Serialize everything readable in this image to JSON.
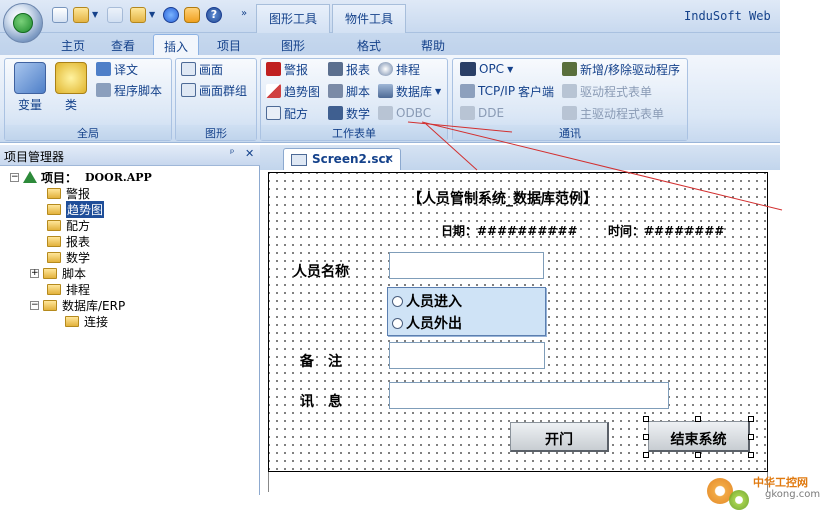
{
  "title_bar": {
    "brand": "InduSoft Web",
    "context_tabs": [
      "图形工具",
      "物件工具"
    ]
  },
  "tabs": [
    {
      "label": "主页"
    },
    {
      "label": "查看"
    },
    {
      "label": "插入",
      "active": true
    },
    {
      "label": "项目"
    },
    {
      "label": "图形"
    },
    {
      "label": "格式"
    },
    {
      "label": "帮助"
    }
  ],
  "ribbon": {
    "global": {
      "label": "全局",
      "variables": "变量",
      "classes": "类",
      "translate": "译文",
      "program_script": "程序脚本"
    },
    "graphics": {
      "label": "图形",
      "screen": "画面",
      "screen_group": "画面群组"
    },
    "worksheets": {
      "label": "工作表单",
      "alarm": "警报",
      "report": "报表",
      "schedule": "排程",
      "trend": "趋势图",
      "script": "脚本",
      "database": "数据库",
      "recipe": "配方",
      "math": "数学",
      "odbc": "ODBC"
    },
    "comm": {
      "label": "通讯",
      "opc": "OPC",
      "tcpip": "TCP/IP",
      "client": "客户端",
      "dde": "DDE",
      "add_remove_driver": "新增/移除驱动程序",
      "driver_sheet": "驱动程式表单",
      "main_driver_sheet": "主驱动程式表单"
    }
  },
  "project_manager": {
    "title": "项目管理器",
    "pin": "ᵖ",
    "close": "✕",
    "root_label": "项目：",
    "root_name": "DOOR.APP",
    "items": [
      "警报",
      "趋势图",
      "配方",
      "报表",
      "数学",
      "脚本",
      "排程",
      "数据库/ERP",
      "连接"
    ],
    "selected": "趋势图"
  },
  "document_tab": {
    "label": "Screen2.scr",
    "close": "✕"
  },
  "screen": {
    "heading": "【人员管制系统_数据库范例】",
    "date_label": "日期：##########",
    "time_label": "时间：########",
    "name_label": "人员名称",
    "radio_in": "人员进入",
    "radio_out": "人员外出",
    "remark_label": "备　注",
    "message_label": "讯　息",
    "open_button": "开门",
    "exit_button": "结束系统"
  },
  "watermark": {
    "brand": "中华工控网",
    "domain": "gkong.com"
  },
  "colors": {
    "ribbon_text": "#15428b",
    "annotation_line": "#d23030"
  }
}
